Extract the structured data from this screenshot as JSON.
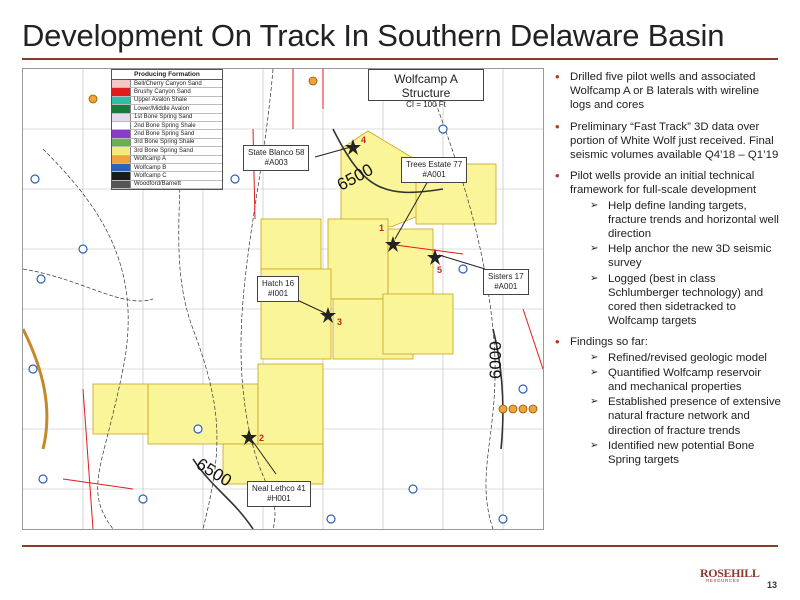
{
  "title": "Development On Track In Southern Delaware Basin",
  "legend": {
    "title": "Producing Formation",
    "items": [
      {
        "label": "Bell/Cherry Canyon Sand",
        "color": "#f5c6c6"
      },
      {
        "label": "Brushy Canyon Sand",
        "color": "#e21b1b"
      },
      {
        "label": "Upper Avalon Shale",
        "color": "#27c3a8"
      },
      {
        "label": "Lower/Middle Avalon",
        "color": "#1a7a3a"
      },
      {
        "label": "1st Bone Spring Sand",
        "color": "#e8d8ee"
      },
      {
        "label": "2nd Bone Spring Shale",
        "color": "#ffffff"
      },
      {
        "label": "2nd Bone Spring Sand",
        "color": "#8b3cc4"
      },
      {
        "label": "3rd Bone Spring Shale",
        "color": "#6ab04c"
      },
      {
        "label": "3rd Bone Spring Sand",
        "color": "#f4ec7a"
      },
      {
        "label": "Wolfcamp A",
        "color": "#f2a23a"
      },
      {
        "label": "Wolfcamp B",
        "color": "#2e62b6"
      },
      {
        "label": "Wolfcamp C",
        "color": "#1b1b1b"
      },
      {
        "label": "Woodford/Barnett",
        "color": "#555555"
      }
    ]
  },
  "structure_box": {
    "title": "Wolfcamp A Structure",
    "subtitle": "CI = 100 Ft"
  },
  "contours": [
    "6500",
    "6000",
    "6500"
  ],
  "wells": [
    {
      "name": "State Blanco 58",
      "id": "#A003",
      "num": "4"
    },
    {
      "name": "Trees Estate 77",
      "id": "#A001",
      "num": "1"
    },
    {
      "name": "Sisters 17",
      "id": "#A001",
      "num": "5"
    },
    {
      "name": "Hatch 16",
      "id": "#I001",
      "num": "3"
    },
    {
      "name": "Neal Lethco 41",
      "id": "#H001",
      "num": "2"
    }
  ],
  "bullets": [
    {
      "text": "Drilled five pilot wells and associated Wolfcamp A or B laterals with wireline logs and cores",
      "subs": []
    },
    {
      "text": "Preliminary “Fast Track” 3D data over portion of White Wolf just received. Final seismic volumes available Q4’18 – Q1’19",
      "subs": []
    },
    {
      "text": "Pilot wells provide an initial technical framework for full-scale development",
      "subs": [
        "Help define landing targets, fracture trends and horizontal well direction",
        "Help anchor the new 3D seismic survey",
        "Logged (best in class Schlumberger technology) and cored then sidetracked to Wolfcamp targets"
      ]
    },
    {
      "text": "Findings so far:",
      "subs": [
        "Refined/revised geologic model",
        "Quantified Wolfcamp reservoir and mechanical properties",
        "Established presence of extensive natural fracture network and direction of fracture trends",
        "Identified new potential Bone Spring targets"
      ]
    }
  ],
  "logo": {
    "word": "ROSEHILL",
    "sub": "RESOURCES"
  },
  "page_number": "13",
  "colors": {
    "accent": "#8b3a2e",
    "acreage": "#fbf59a",
    "boundary": "#e21b1b",
    "well_blue": "#2e62b6"
  }
}
